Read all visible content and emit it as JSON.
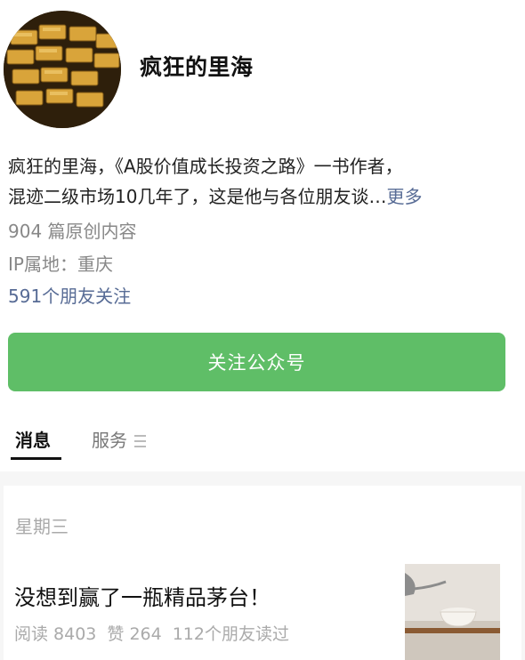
{
  "account": {
    "name": "疯狂的里海",
    "bio_line1": "疯狂的里海，《A股价值成长投资之路》一书作者，",
    "bio_line2": "混迹二级市场10几年了，这是他与各位朋友谈…",
    "more_label": "更多",
    "original_count": "904 篇原创内容",
    "ip_location": "IP属地：重庆",
    "followers": "591个朋友关注"
  },
  "follow_button": {
    "label": "关注公众号"
  },
  "tabs": [
    {
      "label": "消息",
      "active": true
    },
    {
      "label": "服务",
      "active": false
    }
  ],
  "feed": {
    "day": "星期三",
    "article": {
      "title": "没想到赢了一瓶精品茅台！",
      "reads": "阅读 8403",
      "likes": "赞 264",
      "friends_read": "112个朋友读过"
    }
  },
  "colors": {
    "accent_green": "#5fbe67",
    "link_blue": "#576b95"
  }
}
